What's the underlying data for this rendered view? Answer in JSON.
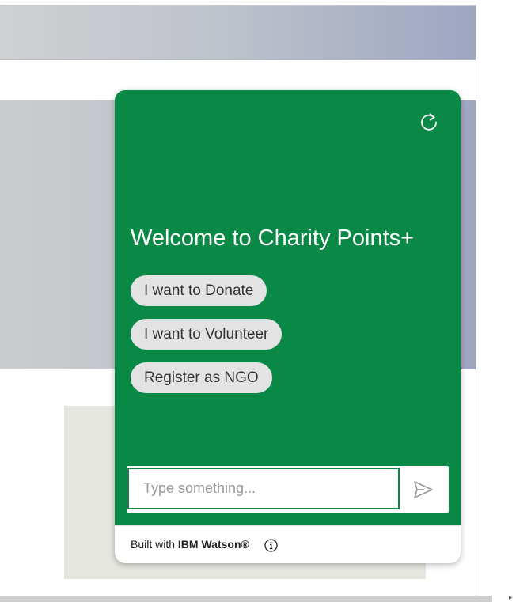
{
  "chat": {
    "welcome_title": "Welcome to Charity Points+",
    "options": [
      "I want to Donate",
      "I want to Volunteer",
      "Register as NGO"
    ],
    "input": {
      "placeholder": "Type something...",
      "value": ""
    },
    "footer": {
      "prefix": "Built with ",
      "brand": "IBM Watson®"
    },
    "icons": {
      "restart": "restart-icon",
      "send": "send-icon",
      "info": "info-icon"
    }
  },
  "colors": {
    "chat_background": "#0a8846",
    "chip_background": "#e2e3e2",
    "input_border": "#0a8846"
  }
}
